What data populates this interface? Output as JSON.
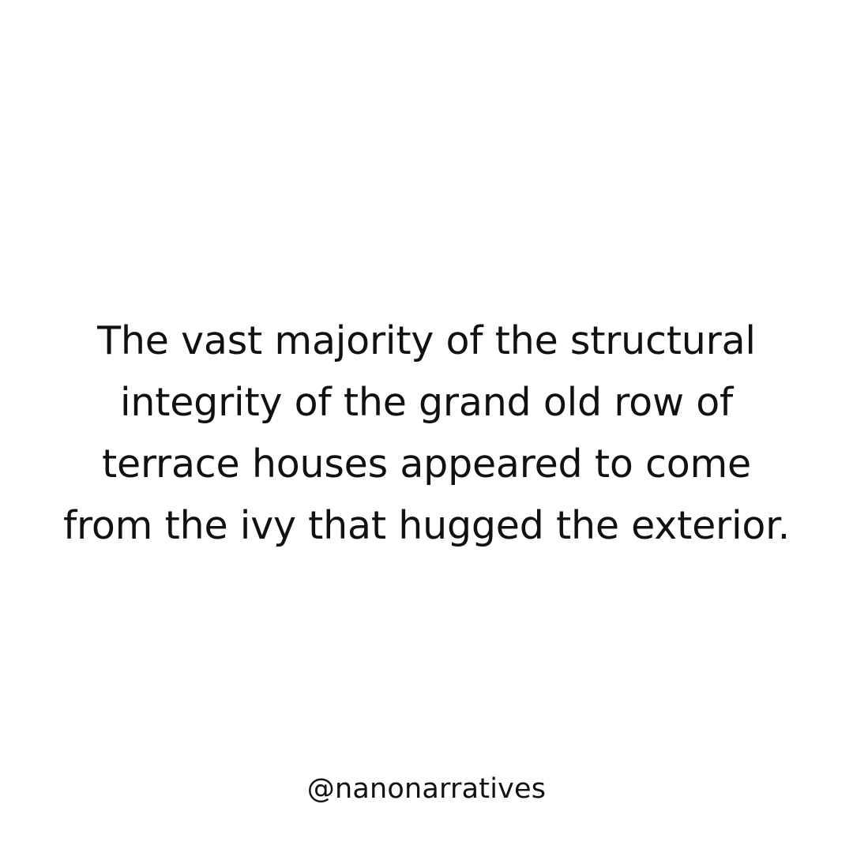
{
  "post": {
    "background_color": "#ffffff",
    "text_color": "#111111",
    "quote_lines": [
      "The vast majority of the structural",
      "integrity of the grand old row of",
      "terrace houses appeared to come",
      "from the ivy that hugged the exterior."
    ],
    "handle": "@nanonarratives"
  }
}
